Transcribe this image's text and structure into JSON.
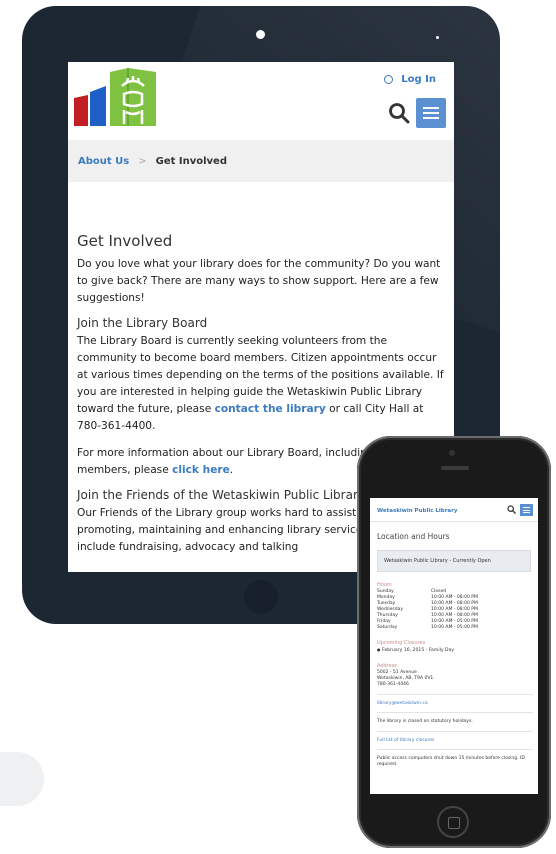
{
  "tablet": {
    "header": {
      "login_label": "Log In"
    },
    "breadcrumb": {
      "parent": "About Us",
      "separator": ">",
      "current": "Get Involved"
    },
    "content": {
      "title": "Get Involved",
      "intro": "Do you love what your library does for the community?  Do you want to give back?  There are many ways to show support.  Here are a few suggestions!",
      "board_heading": "Join the Library Board",
      "board_text_1": "The Library Board is currently seeking volunteers from the community to become board members. Citizen appointments occur at various times depending on the terms of the positions available. If you are interested in helping guide the Wetaskiwin Public Library toward the future, please ",
      "board_link": "contact the library",
      "board_text_2": " or call City Hall at 780-361-4400.",
      "more_text_1": "For more information about our Library Board, including current members, please ",
      "more_link": "click here",
      "more_text_2": ".",
      "friends_heading": "Join the Friends of the Wetaskiwin Public Library",
      "friends_text": "Our Friends of the Library group works hard to assist the library in promoting, maintaining and enhancing library services. Their efforts include fundraising, advocacy and talking"
    }
  },
  "phone": {
    "site_name": "Wetaskiwin Public Library",
    "page_title": "Location and Hours",
    "status": "Wetaskiwin Public Library - Currently Open",
    "hours_label": "Hours",
    "hours": [
      {
        "day": "Sunday",
        "time": "Closed"
      },
      {
        "day": "Monday",
        "time": "10:00 AM - 08:00 PM"
      },
      {
        "day": "Tuesday",
        "time": "10:00 AM - 08:00 PM"
      },
      {
        "day": "Wednesday",
        "time": "10:00 AM - 08:00 PM"
      },
      {
        "day": "Thursday",
        "time": "10:00 AM - 08:00 PM"
      },
      {
        "day": "Friday",
        "time": "10:00 AM - 05:00 PM"
      },
      {
        "day": "Saturday",
        "time": "10:00 AM - 05:00 PM"
      }
    ],
    "closures_label": "Upcoming Closures",
    "closure_item": "February 16, 2015 - Family Day",
    "address_label": "Address",
    "address_lines": [
      "5002 - 51 Avenue",
      "Wetaskiwin, AB, T9A 0V1",
      "780-361-4446"
    ],
    "email": "library@wetaskiwin.ca",
    "holiday_note": "The library is closed on statutory holidays.",
    "closures_link": "Full list of library closures",
    "computer_note": "Public access computers shut down 15 minutes before closing. ID required."
  },
  "colors": {
    "accent": "#3b7bbf",
    "menu_button": "#5a8fd1",
    "tablet_bezel": "#1d2733",
    "breadcrumb_bg": "#f0f0f0",
    "logo_red": "#c21f24",
    "logo_blue": "#1f5fc7",
    "logo_green": "#7fc241"
  },
  "icons": {
    "login": "login-icon",
    "search": "search-icon",
    "menu": "hamburger-menu-icon",
    "logo": "library-books-logo"
  }
}
